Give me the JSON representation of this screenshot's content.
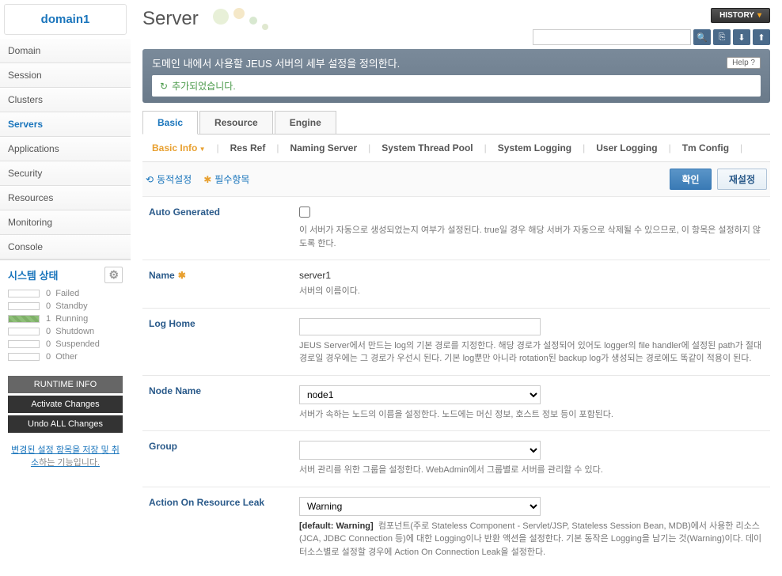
{
  "sidebar": {
    "header": "domain1",
    "items": [
      {
        "label": "Domain",
        "active": false
      },
      {
        "label": "Session",
        "active": false
      },
      {
        "label": "Clusters",
        "active": false
      },
      {
        "label": "Servers",
        "active": true
      },
      {
        "label": "Applications",
        "active": false
      },
      {
        "label": "Security",
        "active": false
      },
      {
        "label": "Resources",
        "active": false
      },
      {
        "label": "Monitoring",
        "active": false
      },
      {
        "label": "Console",
        "active": false
      }
    ],
    "status_title": "시스템 상태",
    "status": [
      {
        "count": "0",
        "label": "Failed"
      },
      {
        "count": "0",
        "label": "Standby"
      },
      {
        "count": "1",
        "label": "Running"
      },
      {
        "count": "0",
        "label": "Shutdown"
      },
      {
        "count": "0",
        "label": "Suspended"
      },
      {
        "count": "0",
        "label": "Other"
      }
    ],
    "buttons": {
      "runtime": "RUNTIME INFO",
      "activate": "Activate Changes",
      "undo": "Undo ALL Changes"
    },
    "note_link": "변경된 설정 항목을 저장 및 취소",
    "note_text": "하는 기능입니다."
  },
  "header": {
    "title": "Server",
    "history": "HISTORY"
  },
  "info": {
    "title": "도메인 내에서 사용할 JEUS 서버의 세부 설정을 정의한다.",
    "help": "Help",
    "message": "추가되었습니다."
  },
  "tabs": [
    {
      "label": "Basic",
      "active": true
    },
    {
      "label": "Resource",
      "active": false
    },
    {
      "label": "Engine",
      "active": false
    }
  ],
  "subtabs": [
    {
      "label": "Basic Info",
      "active": true
    },
    {
      "label": "Res Ref",
      "active": false
    },
    {
      "label": "Naming Server",
      "active": false
    },
    {
      "label": "System Thread Pool",
      "active": false
    },
    {
      "label": "System Logging",
      "active": false
    },
    {
      "label": "User Logging",
      "active": false
    },
    {
      "label": "Tm Config",
      "active": false
    }
  ],
  "legend": {
    "dynamic": "동적설정",
    "required": "필수항목",
    "confirm": "확인",
    "reset": "재설정"
  },
  "form": {
    "auto_generated": {
      "label": "Auto Generated",
      "desc": "이 서버가 자동으로 생성되었는지 여부가 설정된다. true일 경우 해당 서버가 자동으로 삭제될 수 있으므로, 이 항목은 설정하지 않도록 한다."
    },
    "name": {
      "label": "Name",
      "value": "server1",
      "desc": "서버의 이름이다."
    },
    "log_home": {
      "label": "Log Home",
      "value": "",
      "desc": "JEUS Server에서 만드는 log의 기본 경로를 지정한다. 해당 경로가 설정되어 있어도 logger의 file handler에 설정된 path가 절대 경로일 경우에는 그 경로가 우선시 된다. 기본 log뿐만 아니라 rotation된 backup log가 생성되는 경로에도 똑같이 적용이 된다."
    },
    "node_name": {
      "label": "Node Name",
      "value": "node1",
      "desc": "서버가 속하는 노드의 이름을 설정한다. 노드에는 머신 정보, 호스트 정보 등이 포함된다."
    },
    "group": {
      "label": "Group",
      "value": "",
      "desc": "서버 관리를 위한 그룹을 설정한다. WebAdmin에서 그룹별로 서버를 관리할 수 있다."
    },
    "action_leak": {
      "label": "Action On Resource Leak",
      "value": "Warning",
      "default": "[default: Warning]",
      "desc": "컴포넌트(주로 Stateless Component - Servlet/JSP, Stateless Session Bean, MDB)에서 사용한 리소스(JCA, JDBC Connection 등)에 대한 Logging이나 반환 액션을 설정한다. 기본 동작은 Logging을 남기는 것(Warning)이다. 데이터소스별로 설정할 경우에 Action On Connection Leak을 설정한다."
    }
  }
}
